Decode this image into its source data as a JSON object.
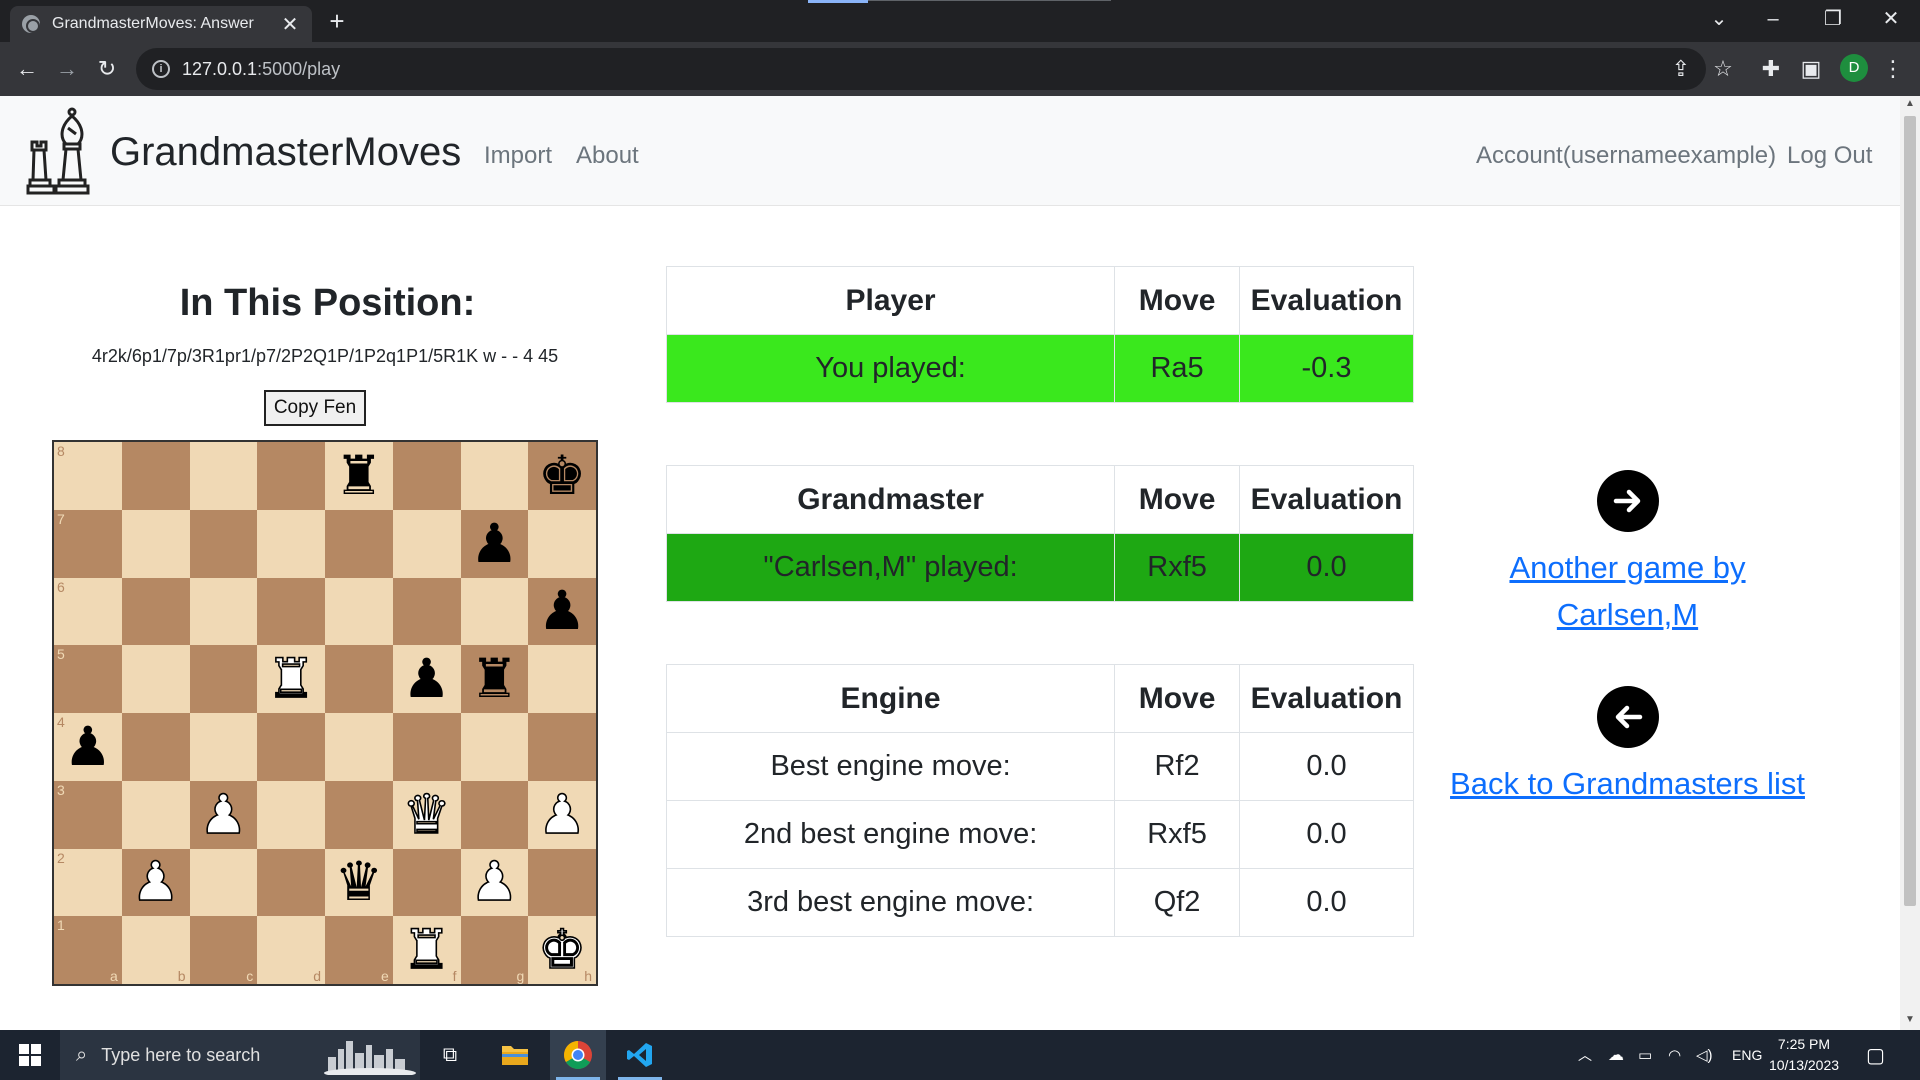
{
  "browser": {
    "tab_title": "GrandmasterMoves: Answer",
    "url_host": "127.0.0.1",
    "url_rest": ":5000/play",
    "profile_initial": "D"
  },
  "nav": {
    "brand": "GrandmasterMoves",
    "links": [
      "Import",
      "About"
    ],
    "account": "Account(usernameexample)",
    "logout": "Log Out"
  },
  "position": {
    "heading": "In This Position:",
    "fen": "4r2k/6p1/7p/3R1pr1/p7/2P2Q1P/1P2q1P1/5R1K w - - 4 45",
    "copy_label": "Copy Fen",
    "ranks": [
      "8",
      "7",
      "6",
      "5",
      "4",
      "3",
      "2",
      "1"
    ],
    "files": [
      "a",
      "b",
      "c",
      "d",
      "e",
      "f",
      "g",
      "h"
    ]
  },
  "player_table": {
    "headers": [
      "Player",
      "Move",
      "Evaluation"
    ],
    "row": [
      "You played:",
      "Ra5",
      "-0.3"
    ]
  },
  "gm_table": {
    "headers": [
      "Grandmaster",
      "Move",
      "Evaluation"
    ],
    "row": [
      "\"Carlsen,M\" played:",
      "Rxf5",
      "0.0"
    ]
  },
  "engine_table": {
    "headers": [
      "Engine",
      "Move",
      "Evaluation"
    ],
    "rows": [
      [
        "Best engine move:",
        "Rf2",
        "0.0"
      ],
      [
        "2nd best engine move:",
        "Rxf5",
        "0.0"
      ],
      [
        "3rd best engine move:",
        "Qf2",
        "0.0"
      ]
    ]
  },
  "side_links": {
    "another_line1": "Another game by",
    "another_line2": "Carlsen,M",
    "back": "Back to Grandmasters list"
  },
  "colors": {
    "player_row": "#3ae81d",
    "gm_row": "#1ea813",
    "board_light": "#f0d9b5",
    "board_dark": "#b58863",
    "link": "#0d6efd"
  },
  "taskbar": {
    "search_placeholder": "Type here to search",
    "lang": "ENG",
    "time": "7:25 PM",
    "date": "10/13/2023"
  }
}
